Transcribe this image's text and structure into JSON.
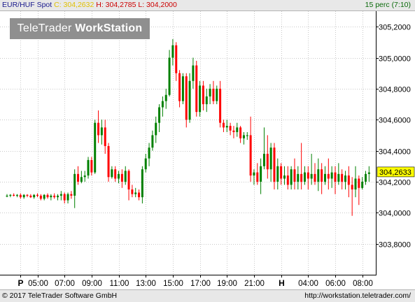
{
  "header": {
    "symbol": "EUR/HUF Spot",
    "close_label": "C: 304,2632",
    "hl_label": "H: 304,2785 L: 304,2000",
    "period": "15 perc (7:10)"
  },
  "logo": {
    "prefix": "TeleTrader",
    "suffix": "WorkStation"
  },
  "footer": {
    "copyright": "© 2017 TeleTrader Software GmbH",
    "url": "http://workstation.teletrader.com/"
  },
  "colors": {
    "up": "#008000",
    "down": "#ff0000",
    "grid": "#c8c8c8",
    "marker": "#ffff00"
  },
  "chart_data": {
    "type": "candlestick",
    "ylim": [
      303.6,
      305.3
    ],
    "y_ticks": [
      303.8,
      304.0,
      304.2,
      304.4,
      304.6,
      304.8,
      305.0,
      305.2
    ],
    "y_tick_labels": [
      "303,8000",
      "304,0000",
      "304,2000",
      "304,4000",
      "304,6000",
      "304,8000",
      "305,0000",
      "305,2000"
    ],
    "last_value": 304.2633,
    "last_value_label": "304,2633",
    "x_ticks": [
      {
        "index": 4,
        "label": "P",
        "bold": true
      },
      {
        "index": 9,
        "label": "05:00"
      },
      {
        "index": 17,
        "label": "07:00"
      },
      {
        "index": 25,
        "label": "09:00"
      },
      {
        "index": 33,
        "label": "11:00"
      },
      {
        "index": 41,
        "label": "13:00"
      },
      {
        "index": 49,
        "label": "15:00"
      },
      {
        "index": 57,
        "label": "17:00"
      },
      {
        "index": 65,
        "label": "19:00"
      },
      {
        "index": 73,
        "label": "21:00"
      },
      {
        "index": 81,
        "label": "H",
        "bold": true
      },
      {
        "index": 89,
        "label": "04:00"
      },
      {
        "index": 97,
        "label": "06:00"
      },
      {
        "index": 105,
        "label": "08:00"
      }
    ],
    "candles": [
      [
        304.11,
        304.12,
        304.1,
        304.11
      ],
      [
        304.11,
        304.12,
        304.1,
        304.115
      ],
      [
        304.115,
        304.125,
        304.105,
        304.11
      ],
      [
        304.11,
        304.12,
        304.1,
        304.115
      ],
      [
        304.115,
        304.125,
        304.09,
        304.1
      ],
      [
        304.1,
        304.12,
        304.09,
        304.115
      ],
      [
        304.115,
        304.12,
        304.1,
        304.11
      ],
      [
        304.11,
        304.12,
        304.095,
        304.1
      ],
      [
        304.1,
        304.12,
        304.09,
        304.115
      ],
      [
        304.115,
        304.125,
        304.1,
        304.11
      ],
      [
        304.11,
        304.12,
        304.08,
        304.09
      ],
      [
        304.09,
        304.12,
        304.08,
        304.115
      ],
      [
        304.115,
        304.125,
        304.09,
        304.1
      ],
      [
        304.1,
        304.12,
        304.08,
        304.11
      ],
      [
        304.11,
        304.125,
        304.09,
        304.1
      ],
      [
        304.1,
        304.12,
        304.08,
        304.11
      ],
      [
        304.11,
        304.14,
        304.08,
        304.12
      ],
      [
        304.12,
        304.13,
        304.06,
        304.08
      ],
      [
        304.08,
        304.13,
        304.06,
        304.12
      ],
      [
        304.12,
        304.14,
        304.09,
        304.11
      ],
      [
        304.11,
        304.28,
        304.03,
        304.25
      ],
      [
        304.25,
        304.3,
        304.18,
        304.2
      ],
      [
        304.2,
        304.27,
        304.19,
        304.23
      ],
      [
        304.23,
        304.27,
        304.2,
        304.24
      ],
      [
        304.24,
        304.36,
        304.22,
        304.34
      ],
      [
        304.34,
        304.36,
        304.24,
        304.26
      ],
      [
        304.26,
        304.6,
        304.25,
        304.58
      ],
      [
        304.58,
        304.66,
        304.45,
        304.5
      ],
      [
        304.5,
        304.6,
        304.44,
        304.55
      ],
      [
        304.55,
        304.6,
        304.38,
        304.43
      ],
      [
        304.43,
        304.45,
        304.2,
        304.23
      ],
      [
        304.23,
        304.3,
        304.22,
        304.28
      ],
      [
        304.28,
        304.3,
        304.2,
        304.22
      ],
      [
        304.22,
        304.27,
        304.19,
        304.25
      ],
      [
        304.25,
        304.28,
        304.16,
        304.2
      ],
      [
        304.2,
        304.3,
        304.18,
        304.27
      ],
      [
        304.27,
        304.28,
        304.08,
        304.15
      ],
      [
        304.15,
        304.18,
        304.1,
        304.12
      ],
      [
        304.12,
        304.16,
        304.1,
        304.13
      ],
      [
        304.13,
        304.15,
        304.08,
        304.1
      ],
      [
        304.1,
        304.3,
        304.06,
        304.28
      ],
      [
        304.28,
        304.38,
        304.26,
        304.35
      ],
      [
        304.35,
        304.45,
        304.3,
        304.42
      ],
      [
        304.42,
        304.53,
        304.4,
        304.5
      ],
      [
        304.5,
        304.62,
        304.45,
        304.58
      ],
      [
        304.58,
        304.7,
        304.52,
        304.68
      ],
      [
        304.68,
        304.75,
        304.62,
        304.72
      ],
      [
        304.72,
        304.8,
        304.67,
        304.76
      ],
      [
        304.76,
        305.05,
        304.75,
        305.0
      ],
      [
        305.0,
        305.12,
        304.95,
        305.08
      ],
      [
        305.08,
        305.1,
        304.85,
        304.9
      ],
      [
        304.9,
        304.92,
        304.68,
        304.72
      ],
      [
        304.72,
        304.9,
        304.7,
        304.88
      ],
      [
        304.88,
        304.9,
        304.55,
        304.6
      ],
      [
        304.6,
        304.9,
        304.58,
        304.85
      ],
      [
        304.85,
        305.0,
        304.8,
        304.95
      ],
      [
        304.95,
        304.98,
        304.62,
        304.65
      ],
      [
        304.65,
        304.85,
        304.62,
        304.82
      ],
      [
        304.82,
        304.85,
        304.66,
        304.7
      ],
      [
        304.7,
        304.8,
        304.65,
        304.75
      ],
      [
        304.75,
        304.83,
        304.7,
        304.8
      ],
      [
        304.8,
        304.85,
        304.7,
        304.72
      ],
      [
        304.72,
        304.82,
        304.7,
        304.8
      ],
      [
        304.8,
        304.85,
        304.55,
        304.58
      ],
      [
        304.58,
        304.6,
        304.52,
        304.55
      ],
      [
        304.55,
        304.6,
        304.52,
        304.56
      ],
      [
        304.56,
        304.58,
        304.5,
        304.53
      ],
      [
        304.53,
        304.56,
        304.48,
        304.52
      ],
      [
        304.52,
        304.58,
        304.49,
        304.55
      ],
      [
        304.55,
        304.56,
        304.45,
        304.48
      ],
      [
        304.48,
        304.52,
        304.44,
        304.5
      ],
      [
        304.5,
        304.52,
        304.47,
        304.5
      ],
      [
        304.5,
        304.62,
        304.2,
        304.24
      ],
      [
        304.24,
        304.28,
        304.18,
        304.26
      ],
      [
        304.26,
        304.32,
        304.18,
        304.2
      ],
      [
        304.2,
        304.35,
        304.12,
        304.3
      ],
      [
        304.3,
        304.55,
        304.28,
        304.38
      ],
      [
        304.38,
        304.5,
        304.22,
        304.28
      ],
      [
        304.28,
        304.45,
        304.2,
        304.42
      ],
      [
        304.42,
        304.45,
        304.15,
        304.2
      ],
      [
        304.2,
        304.35,
        304.15,
        304.3
      ],
      [
        304.3,
        304.32,
        304.18,
        304.22
      ],
      [
        304.22,
        304.3,
        304.18,
        304.24
      ],
      [
        304.24,
        304.3,
        304.15,
        304.18
      ],
      [
        304.18,
        304.3,
        304.15,
        304.28
      ],
      [
        304.28,
        304.35,
        304.15,
        304.2
      ],
      [
        304.2,
        304.3,
        304.15,
        304.25
      ],
      [
        304.25,
        304.45,
        304.15,
        304.2
      ],
      [
        304.2,
        304.3,
        304.18,
        304.26
      ],
      [
        304.26,
        304.3,
        304.15,
        304.22
      ],
      [
        304.22,
        304.38,
        304.18,
        304.25
      ],
      [
        304.25,
        304.32,
        304.18,
        304.2
      ],
      [
        304.2,
        304.35,
        304.14,
        304.28
      ],
      [
        304.28,
        304.32,
        304.12,
        304.2
      ],
      [
        304.2,
        304.3,
        304.18,
        304.25
      ],
      [
        304.25,
        304.35,
        304.15,
        304.22
      ],
      [
        304.22,
        304.3,
        304.16,
        304.26
      ],
      [
        304.26,
        304.3,
        304.12,
        304.2
      ],
      [
        304.2,
        304.32,
        304.18,
        304.25
      ],
      [
        304.25,
        304.28,
        304.15,
        304.2
      ],
      [
        304.2,
        304.27,
        304.15,
        304.24
      ],
      [
        304.24,
        304.3,
        304.1,
        304.18
      ],
      [
        304.18,
        304.23,
        303.98,
        304.15
      ],
      [
        304.15,
        304.3,
        304.1,
        304.22
      ],
      [
        304.22,
        304.24,
        304.05,
        304.16
      ],
      [
        304.16,
        304.23,
        304.15,
        304.2
      ],
      [
        304.2,
        304.27,
        304.18,
        304.25
      ],
      [
        304.25,
        304.3,
        304.2,
        304.26
      ]
    ]
  }
}
